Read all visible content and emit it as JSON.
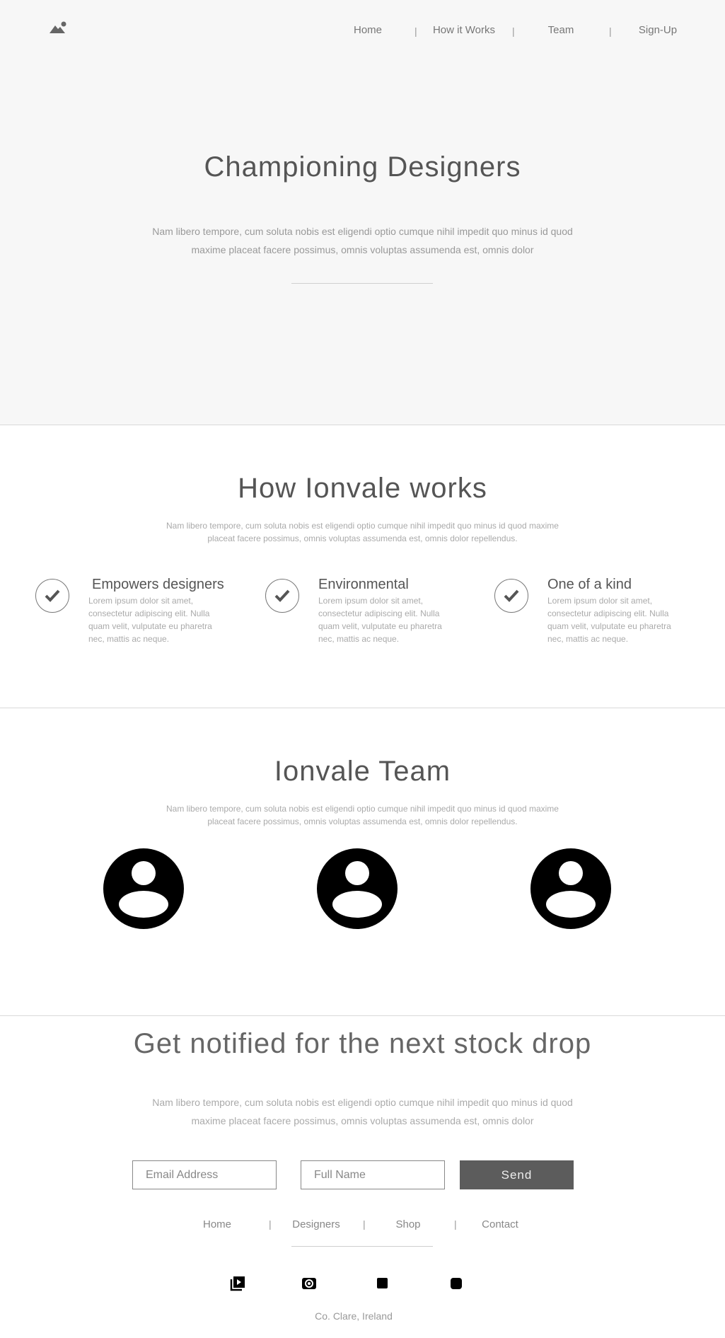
{
  "header": {
    "logo_icon": "mountain-sun-icon",
    "nav": [
      "Home",
      "How it Works",
      "Team",
      "Sign-Up"
    ],
    "separator": "|"
  },
  "hero": {
    "title": "Championing Designers",
    "text": "Nam libero tempore, cum soluta nobis est eligendi optio cumque nihil impedit quo minus id quod maxime placeat facere possimus, omnis voluptas assumenda est, omnis dolor"
  },
  "how": {
    "title": "How Ionvale works",
    "text": "Nam libero tempore, cum soluta nobis est eligendi optio cumque nihil impedit quo minus id quod maxime placeat facere possimus, omnis voluptas assumenda est, omnis dolor repellendus.",
    "features": [
      {
        "title": "Empowers designers",
        "text": "Lorem ipsum dolor sit amet, consectetur adipiscing elit. Nulla quam velit, vulputate eu pharetra nec, mattis ac neque.",
        "icon": "check-icon"
      },
      {
        "title": "Environmental",
        "text": "Lorem ipsum dolor sit amet, consectetur adipiscing elit. Nulla quam velit, vulputate eu pharetra nec, mattis ac neque.",
        "icon": "check-icon"
      },
      {
        "title": "One of a kind",
        "text": "Lorem ipsum dolor sit amet, consectetur adipiscing elit. Nulla quam velit, vulputate eu pharetra nec, mattis ac neque.",
        "icon": "check-icon"
      }
    ]
  },
  "team": {
    "title": "Ionvale Team",
    "text": "Nam libero tempore, cum soluta nobis est eligendi optio cumque nihil impedit quo minus id quod maxime placeat facere possimus, omnis voluptas assumenda est, omnis dolor repellendus.",
    "avatar_icon": "user-avatar-icon"
  },
  "notify": {
    "title": "Get notified for the next stock drop",
    "text": "Nam libero tempore, cum soluta nobis est eligendi optio cumque nihil impedit quo minus id quod maxime placeat facere possimus, omnis voluptas assumenda est, omnis dolor",
    "email_placeholder": "Email Address",
    "name_placeholder": "Full Name",
    "send_label": "Send"
  },
  "footer": {
    "nav": [
      "Home",
      "Designers",
      "Shop",
      "Contact"
    ],
    "separator": "|",
    "social_icons": [
      "video-play-icon",
      "radio-icon",
      "square-icon",
      "rounded-square-icon"
    ],
    "location": "Co. Clare, Ireland"
  }
}
